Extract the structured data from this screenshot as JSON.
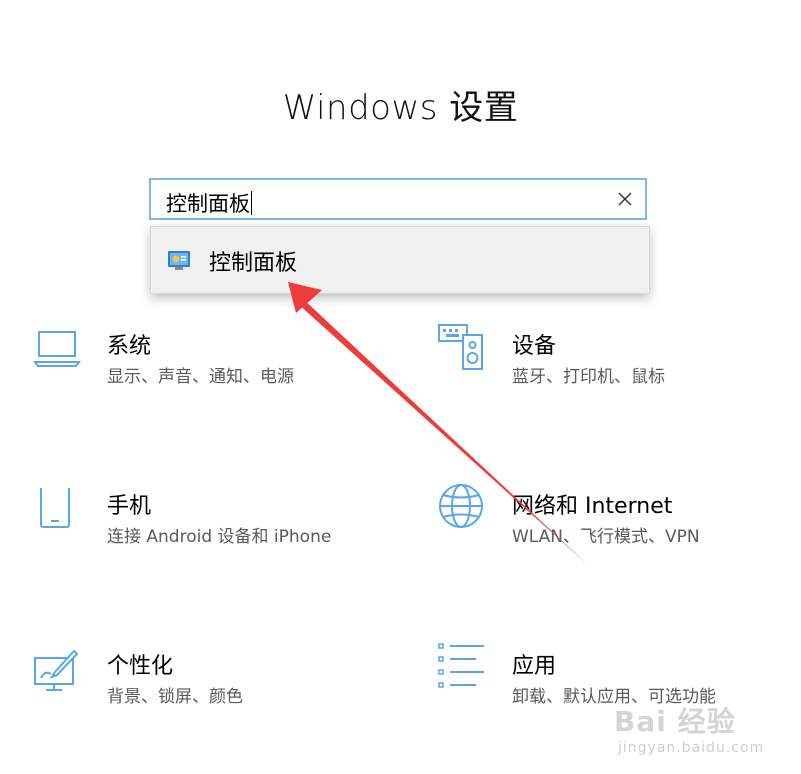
{
  "window": {
    "title": "Windows 设置"
  },
  "search": {
    "value": "控制面板",
    "clear_icon": "close-icon"
  },
  "suggestions": [
    {
      "label": "控制面板",
      "icon": "control-panel-icon"
    }
  ],
  "tiles": [
    {
      "name": "系统",
      "desc": "显示、声音、通知、电源",
      "icon": "laptop-icon"
    },
    {
      "name": "设备",
      "desc": "蓝牙、打印机、鼠标",
      "icon": "keyboard-speaker-icon"
    },
    {
      "name": "手机",
      "desc": "连接 Android 设备和 iPhone",
      "icon": "phone-icon"
    },
    {
      "name": "网络和 Internet",
      "desc": "WLAN、飞行模式、VPN",
      "icon": "globe-icon"
    },
    {
      "name": "个性化",
      "desc": "背景、锁屏、颜色",
      "icon": "paint-monitor-icon"
    },
    {
      "name": "应用",
      "desc": "卸载、默认应用、可选功能",
      "icon": "app-list-icon"
    }
  ],
  "accent_color": "#0078d7",
  "icon_color": "#5aa6e8",
  "annotation_color": "#ee3b3b",
  "watermark": {
    "brand": "Bai 经验",
    "url": "jingyan.baidu.com"
  }
}
